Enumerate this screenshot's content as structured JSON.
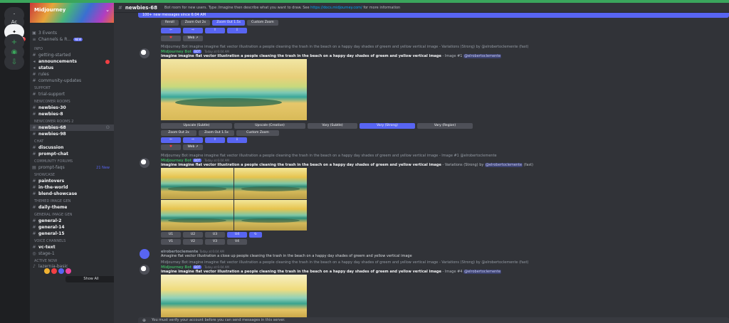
{
  "server": {
    "name": "Midjourney",
    "rail": [
      {
        "label": "⌂",
        "icon": "discord-home-icon"
      },
      {
        "label": "Ac",
        "icon": "server-ac-icon"
      },
      {
        "label": "✦",
        "icon": "midjourney-server-icon",
        "badge": "3"
      },
      {
        "label": "+",
        "icon": "add-server-icon"
      },
      {
        "label": "◉",
        "icon": "explore-icon"
      },
      {
        "label": "⇩",
        "icon": "download-icon"
      }
    ]
  },
  "sidebar": {
    "top": [
      {
        "label": "3 Events",
        "icon": "calendar-icon"
      },
      {
        "label": "Channels & R...",
        "icon": "channels-icon",
        "pill": "NEW"
      }
    ],
    "categories": {
      "info": "INFO",
      "support": "SUPPORT",
      "newcomer1": "NEWCOMER ROOMS",
      "newcomer2": "NEWCOMER ROOMS 2",
      "chat": "CHAT",
      "forums": "COMMUNITY FORUMS",
      "showcase": "SHOWCASE",
      "themed": "THEMED IMAGE GEN",
      "general": "GENERAL IMAGE GEN",
      "voice": "VOICE CHANNELS",
      "active": "ACTIVE NOW"
    },
    "info": [
      "getting-started",
      "announcements",
      "status",
      "rules",
      "community-updates"
    ],
    "support": [
      "trial-support"
    ],
    "newcomer1": [
      "newbies-30",
      "newbies-8"
    ],
    "newcomer2": [
      "newbies-68",
      "newbies-98"
    ],
    "chat": [
      "discussion",
      "prompt-chat"
    ],
    "forums": [
      {
        "label": "prompt-faqs",
        "new": "21 New"
      }
    ],
    "showcase": [
      "paintovers",
      "in-the-world",
      "blend-showcase"
    ],
    "themed": [
      "daily-theme"
    ],
    "general": [
      "general-2",
      "general-14",
      "general-15"
    ],
    "voice": [
      "vc-text",
      "stage-1"
    ],
    "active_item": "lazernia-basic",
    "show_all": "Show All"
  },
  "header": {
    "channel": "newbies-68",
    "topic_text": "Bot room for new users. Type /imagine then describe what you want to draw. See",
    "topic_link": "https://docs.midjourney.com/",
    "topic_tail": "for more information"
  },
  "new_messages": "100+ new messages since 6:04 AM",
  "buttons": {
    "row_a": [
      "Reroll",
      "Zoom Out 2x",
      "Zoom Out 1.5x",
      "Custom Zoom"
    ],
    "row_b": [
      "⇦",
      "⇨",
      "⇧",
      "⇩"
    ],
    "row_c": [
      "♥",
      "Web ↗"
    ],
    "upscale": [
      "Upscale (Subtle)",
      "Upscale (Creative)",
      "Vary (Subtle)",
      "Vary (Strong)",
      "Vary (Region)"
    ],
    "zoom": [
      "Zoom Out 2x",
      "Zoom Out 1.5x",
      "Custom Zoom"
    ],
    "pan": [
      "⇦",
      "⇨",
      "⇧",
      "⇩"
    ],
    "like": [
      "♥",
      "Web ↗"
    ],
    "u_row": [
      "U1",
      "U2",
      "U3",
      "U4",
      "↻"
    ],
    "v_row": [
      "V1",
      "V2",
      "V3",
      "V4"
    ]
  },
  "messages": {
    "m1_reply": "Midjourney Bot  imagine imagine flat vector illustration a people cleaning the trash in the beach on a happy day shades of greem and yellow vertical image - Variations (Strong) by @elrobertoclemente (fast)",
    "m1_author": "Midjourney Bot",
    "m1_badge": "BOT",
    "m1_time": "Today at 6:04 AM",
    "m1_prompt": "imagine imagine flat vector illustration a people cleaning the trash in the beach on a happy day shades of greem and yellow vertical image",
    "m1_suffix": "- Image #1",
    "m1_mention": "@elrobertoclemente",
    "m2_reply": "Midjourney Bot  imagine imagine flat vector illustration a people cleaning the trash in the beach on a happy day shades of greem and yellow vertical image - Image #1 @elrobertoclemente",
    "m2_author": "Midjourney Bot",
    "m2_badge": "BOT",
    "m2_time": "Today at 6:04 AM",
    "m2_prompt": "imagine imagine flat vector illustration a people cleaning the trash in the beach on a happy day shades of greem and yellow vertical image",
    "m2_suffix": "- Variations (Strong) by",
    "m2_mention": "@elrobertoclemente",
    "m2_fast": "(fast)",
    "m3_author": "elrobertoclemente",
    "m3_time": "Today at 6:04 AM",
    "m3_text": "Amagine flat vector illustration a close up people cleaning the trash in the beach on a happy day shades of greem and yellow vertical image",
    "m4_reply": "Midjourney Bot  imagine imagine flat vector illustration a people cleaning the trash in the beach on a happy day shades of greem and yellow vertical image - Variations (Strong) by @elrobertoclemente (fast)",
    "m4_author": "Midjourney Bot",
    "m4_badge": "BOT",
    "m4_time": "Today at 6:04 AM",
    "m4_prompt": "imagine imagine flat vector illustration a people cleaning the trash in the beach on a happy day shades of greem and yellow vertical image",
    "m4_suffix": "- Image #4",
    "m4_mention": "@elrobertoclemente"
  },
  "composer": {
    "placeholder": "You must verify your account before you can send messages in this server."
  },
  "colors": {
    "accent": "#5865f2",
    "online": "#3ba55c",
    "danger": "#f23f43",
    "link": "#00a8fc"
  }
}
